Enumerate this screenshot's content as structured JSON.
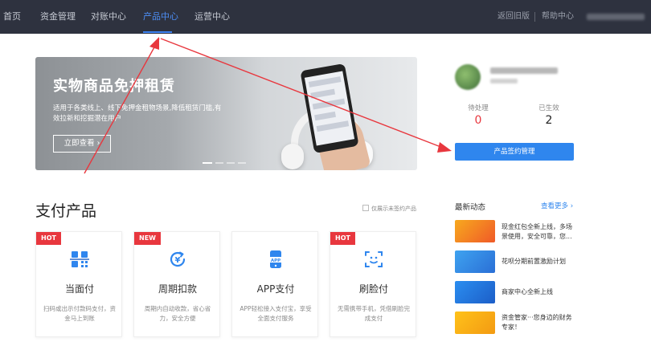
{
  "nav": {
    "items": [
      {
        "label": "首页"
      },
      {
        "label": "资金管理"
      },
      {
        "label": "对账中心"
      },
      {
        "label": "产品中心"
      },
      {
        "label": "运营中心"
      }
    ],
    "active_index": 3,
    "back_old": "返回旧版",
    "help": "帮助中心"
  },
  "banner": {
    "title": "实物商品免押租赁",
    "desc": "适用于各类线上、线下免押金租物场景,降低租赁门槛,有效拉新和挖掘潜在用户",
    "button": "立即查看 ›"
  },
  "account": {
    "pending_label": "待处理",
    "pending_value": "0",
    "active_label": "已生效",
    "active_value": "2",
    "sign_button": "产品签约管理"
  },
  "products": {
    "title": "支付产品",
    "only_unsigned": "仅展示未签约产品",
    "cards": [
      {
        "tag": "HOT",
        "icon": "qr-scan-icon",
        "name": "当面付",
        "desc": "扫码或出示付款码支付，资金马上到账"
      },
      {
        "tag": "NEW",
        "icon": "cycle-deduct-icon",
        "name": "周期扣款",
        "desc": "周期内自动收款，省心省力，安全方便"
      },
      {
        "tag": "",
        "icon": "app-pay-icon",
        "name": "APP支付",
        "desc": "APP轻松接入支付宝，享受全面支付服务"
      },
      {
        "tag": "HOT",
        "icon": "face-pay-icon",
        "name": "刷脸付",
        "desc": "无需携带手机，凭借刷脸完成支付"
      }
    ]
  },
  "news": {
    "title": "最新动态",
    "more": "查看更多 ›",
    "items": [
      {
        "text": "现金红包全新上线，多场景使用，安全可靠，您..."
      },
      {
        "text": "花呗分期前置激励计划"
      },
      {
        "text": "商家中心全新上线"
      },
      {
        "text": "资金管家···您身边的财务专家！"
      }
    ]
  },
  "colors": {
    "topbar": "#2e323f",
    "accent": "#2f86ee",
    "tag_red": "#e8373e",
    "pending_red": "#e8373e",
    "annotation_red": "#e8373e"
  }
}
